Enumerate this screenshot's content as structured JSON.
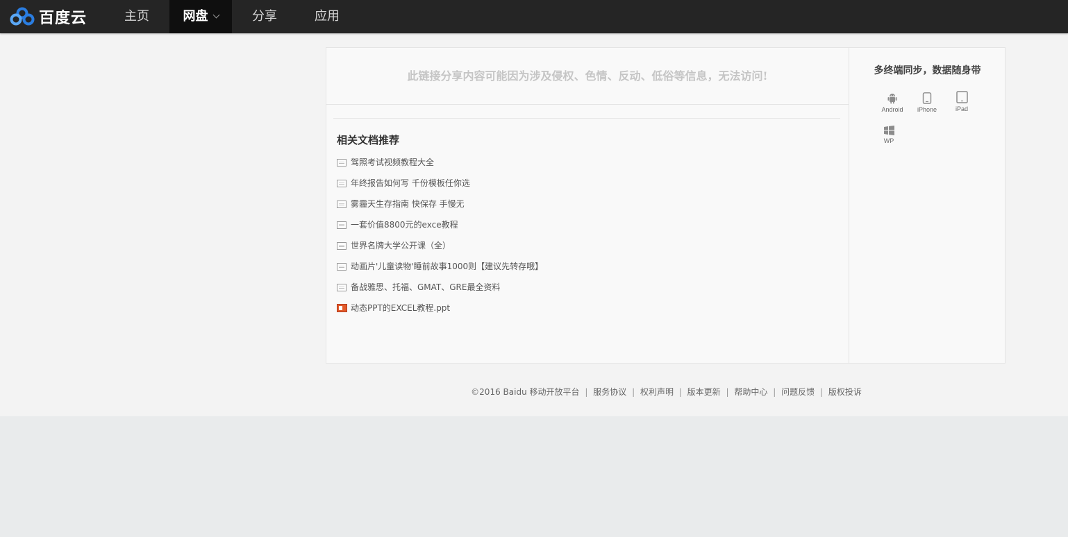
{
  "brand": {
    "name": "百度云",
    "colors": {
      "ring_blue": "#2a7de1",
      "ring_light": "#5aa7f5",
      "topbar": "#252525"
    }
  },
  "nav": {
    "items": [
      {
        "label": "主页",
        "active": false
      },
      {
        "label": "网盘",
        "active": true,
        "has_dropdown": true
      },
      {
        "label": "分享",
        "active": false
      },
      {
        "label": "应用",
        "active": false
      }
    ]
  },
  "notice": {
    "text": "此链接分享内容可能因为涉及侵权、色情、反动、低俗等信息，无法访问!"
  },
  "recommendations": {
    "title": "相关文档推荐",
    "items": [
      {
        "label": "驾照考试视频教程大全",
        "icon": "doc-icon"
      },
      {
        "label": "年终报告如何写 千份模板任你选",
        "icon": "doc-icon"
      },
      {
        "label": "雾霾天生存指南 快保存 手慢无",
        "icon": "doc-icon"
      },
      {
        "label": "一套价值8800元的exce教程",
        "icon": "doc-icon"
      },
      {
        "label": "世界名牌大学公开课（全）",
        "icon": "doc-icon"
      },
      {
        "label": "动画片'儿童读物'睡前故事1000则【建议先转存哦】",
        "icon": "doc-icon"
      },
      {
        "label": "备战雅思、托福、GMAT、GRE最全资料",
        "icon": "doc-icon"
      },
      {
        "label": "动态PPT的EXCEL教程.ppt",
        "icon": "ppt-icon"
      }
    ]
  },
  "sidebar": {
    "title": "多终端同步，数据随身带",
    "devices": [
      {
        "label": "Android",
        "icon": "android-icon"
      },
      {
        "label": "iPhone",
        "icon": "iphone-icon"
      },
      {
        "label": "iPad",
        "icon": "ipad-icon"
      },
      {
        "label": "WP",
        "icon": "windows-icon"
      }
    ]
  },
  "footer": {
    "copyright": "©2016 Baidu",
    "links": [
      "移动开放平台",
      "服务协议",
      "权利声明",
      "版本更新",
      "帮助中心",
      "问题反馈",
      "版权投诉"
    ],
    "separator": "|"
  }
}
